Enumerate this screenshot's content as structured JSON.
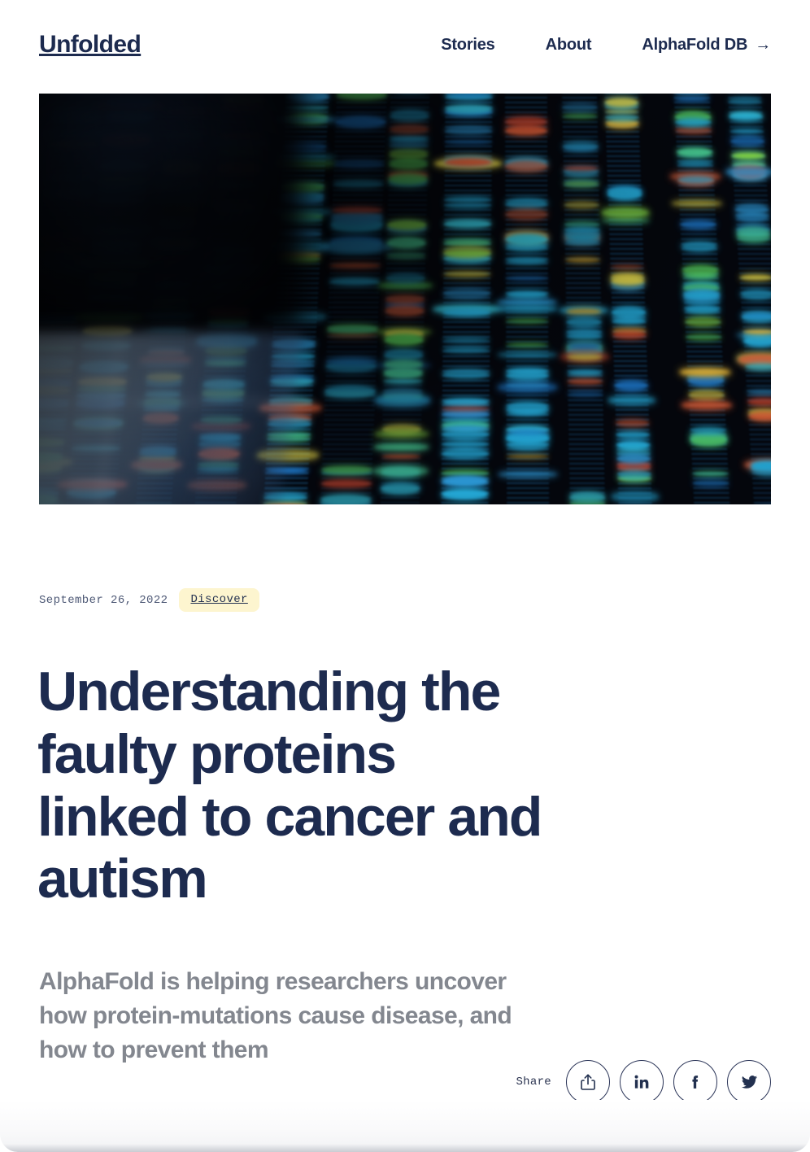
{
  "site": {
    "logo": "Unfolded"
  },
  "nav": {
    "items": [
      {
        "label": "Stories",
        "icon": null
      },
      {
        "label": "About",
        "icon": null
      },
      {
        "label": "AlphaFold DB",
        "icon": "arrow-right-icon",
        "glyph": "→"
      }
    ]
  },
  "hero": {
    "alt": "DNA sequencing gel electrophoresis with coloured bands",
    "image_kind": "dna-sequencing-gel"
  },
  "article": {
    "date": "September 26, 2022",
    "tag": "Discover",
    "title": "Understanding the faulty proteins linked to cancer and autism",
    "deck": "AlphaFold is helping researchers uncover how protein-mutations cause disease, and how to prevent them"
  },
  "share": {
    "label": "Share",
    "buttons": [
      {
        "name": "share-icon",
        "title": "Share"
      },
      {
        "name": "linkedin-icon",
        "title": "LinkedIn"
      },
      {
        "name": "facebook-icon",
        "title": "Facebook"
      },
      {
        "name": "twitter-icon",
        "title": "Twitter"
      }
    ]
  },
  "colors": {
    "ink": "#1d2b4f",
    "muted": "#83878f",
    "tag_bg": "#fdf5cf",
    "page_bg": "#ffffff",
    "hero_bg": "#04060c"
  }
}
